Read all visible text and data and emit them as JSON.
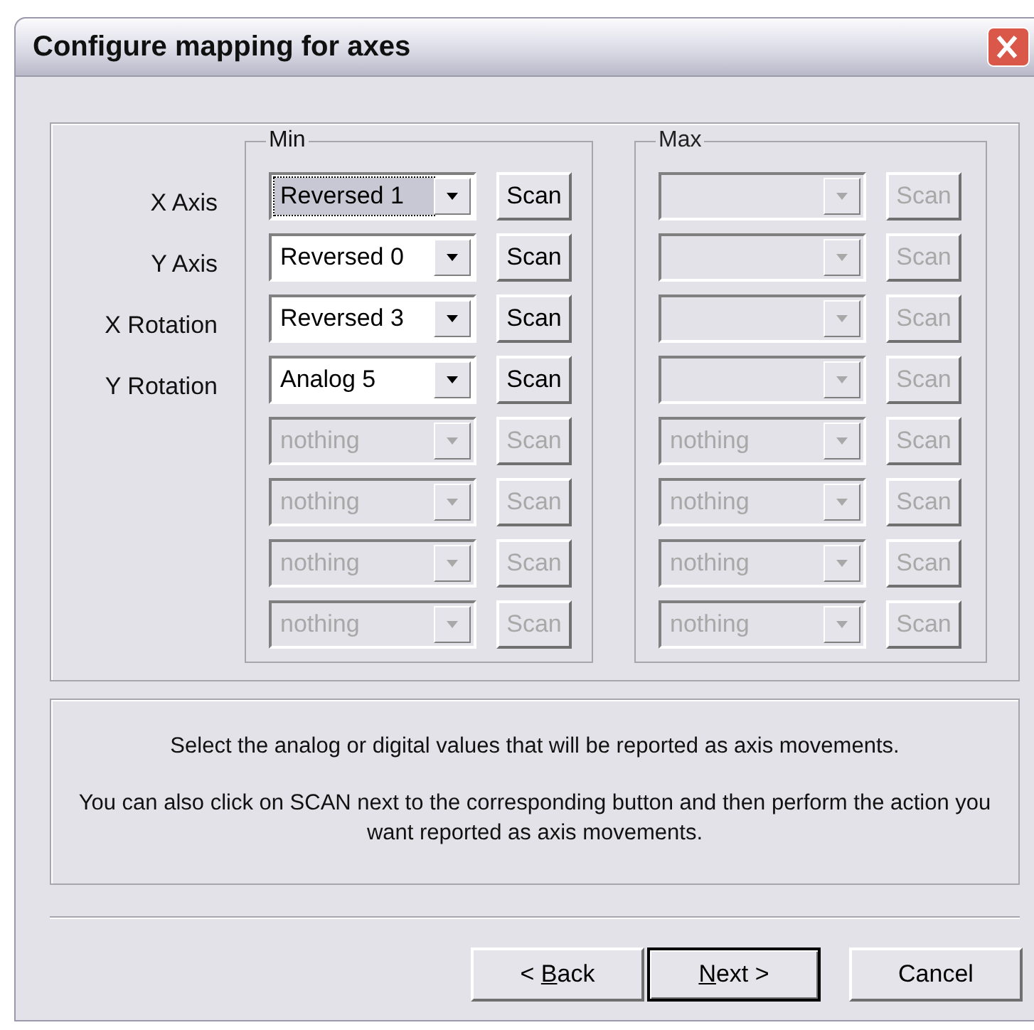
{
  "window": {
    "title": "Configure mapping for axes"
  },
  "groups": [
    {
      "title": "Min"
    },
    {
      "title": "Max"
    }
  ],
  "rows": [
    {
      "label": "X Axis",
      "min": {
        "value": "Reversed 1",
        "scan": "Scan",
        "disabled": false,
        "focused": true
      },
      "max": {
        "scan": "Scan",
        "disabled": true,
        "focused": false
      }
    },
    {
      "label": "Y Axis",
      "min": {
        "value": "Reversed 0",
        "scan": "Scan",
        "disabled": false,
        "focused": false
      },
      "max": {
        "scan": "Scan",
        "disabled": true,
        "focused": false
      }
    },
    {
      "label": "X Rotation",
      "min": {
        "value": "Reversed 3",
        "scan": "Scan",
        "disabled": false,
        "focused": false
      },
      "max": {
        "scan": "Scan",
        "disabled": true,
        "focused": false
      }
    },
    {
      "label": "Y Rotation",
      "min": {
        "value": "Analog 5",
        "scan": "Scan",
        "disabled": false,
        "focused": false
      },
      "max": {
        "scan": "Scan",
        "disabled": true,
        "focused": false
      }
    },
    {
      "min": {
        "value": "nothing",
        "scan": "Scan",
        "disabled": true,
        "focused": false
      },
      "max": {
        "value": "nothing",
        "scan": "Scan",
        "disabled": true,
        "focused": false
      }
    },
    {
      "min": {
        "value": "nothing",
        "scan": "Scan",
        "disabled": true,
        "focused": false
      },
      "max": {
        "value": "nothing",
        "scan": "Scan",
        "disabled": true,
        "focused": false
      }
    },
    {
      "min": {
        "value": "nothing",
        "scan": "Scan",
        "disabled": true,
        "focused": false
      },
      "max": {
        "value": "nothing",
        "scan": "Scan",
        "disabled": true,
        "focused": false
      }
    },
    {
      "min": {
        "value": "nothing",
        "scan": "Scan",
        "disabled": true,
        "focused": false
      },
      "max": {
        "value": "nothing",
        "scan": "Scan",
        "disabled": true,
        "focused": false
      }
    }
  ],
  "info": [
    "Select the analog or digital values that will be reported as axis movements.",
    "You can also click on SCAN next to the corresponding button and then perform the action you want reported as axis movements."
  ],
  "buttons": [
    {
      "label": "< Back",
      "mnemonic_underlined": true,
      "default": false
    },
    {
      "label": "Next >",
      "mnemonic_underlined": true,
      "default": true
    },
    {
      "label": "Cancel",
      "mnemonic_underlined": false,
      "default": false
    }
  ]
}
